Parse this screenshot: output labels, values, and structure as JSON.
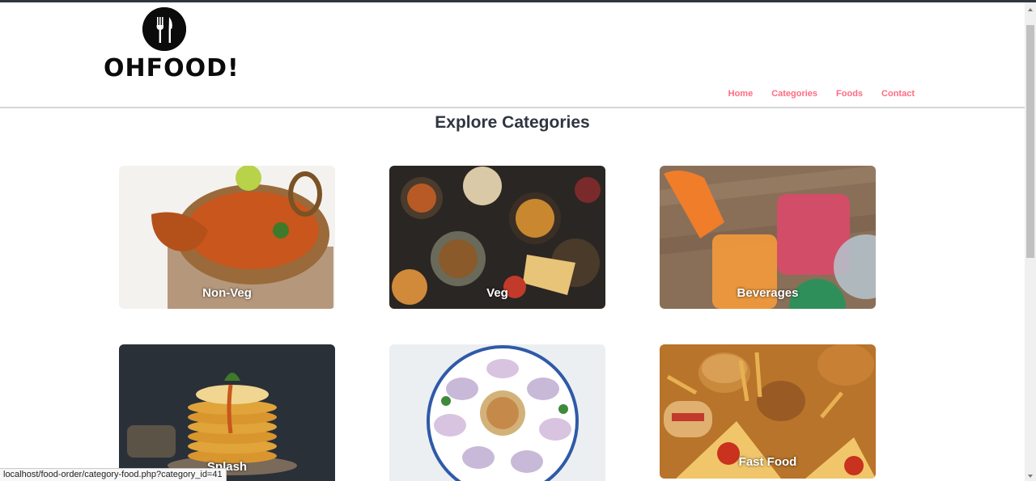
{
  "brand": {
    "name": "OHFOOD!",
    "logo_icon": "fork-knife-icon"
  },
  "nav": {
    "items": [
      {
        "label": "Home"
      },
      {
        "label": "Categories"
      },
      {
        "label": "Foods"
      },
      {
        "label": "Contact"
      }
    ],
    "color": "#ff6b81"
  },
  "page": {
    "title": "Explore Categories"
  },
  "categories": [
    {
      "label": "Non-Veg"
    },
    {
      "label": "Veg"
    },
    {
      "label": "Beverages"
    },
    {
      "label": "Splash"
    },
    {
      "label": ""
    },
    {
      "label": "Fast Food"
    }
  ],
  "status_bar": {
    "url": "localhost/food-order/category-food.php?category_id=41"
  }
}
